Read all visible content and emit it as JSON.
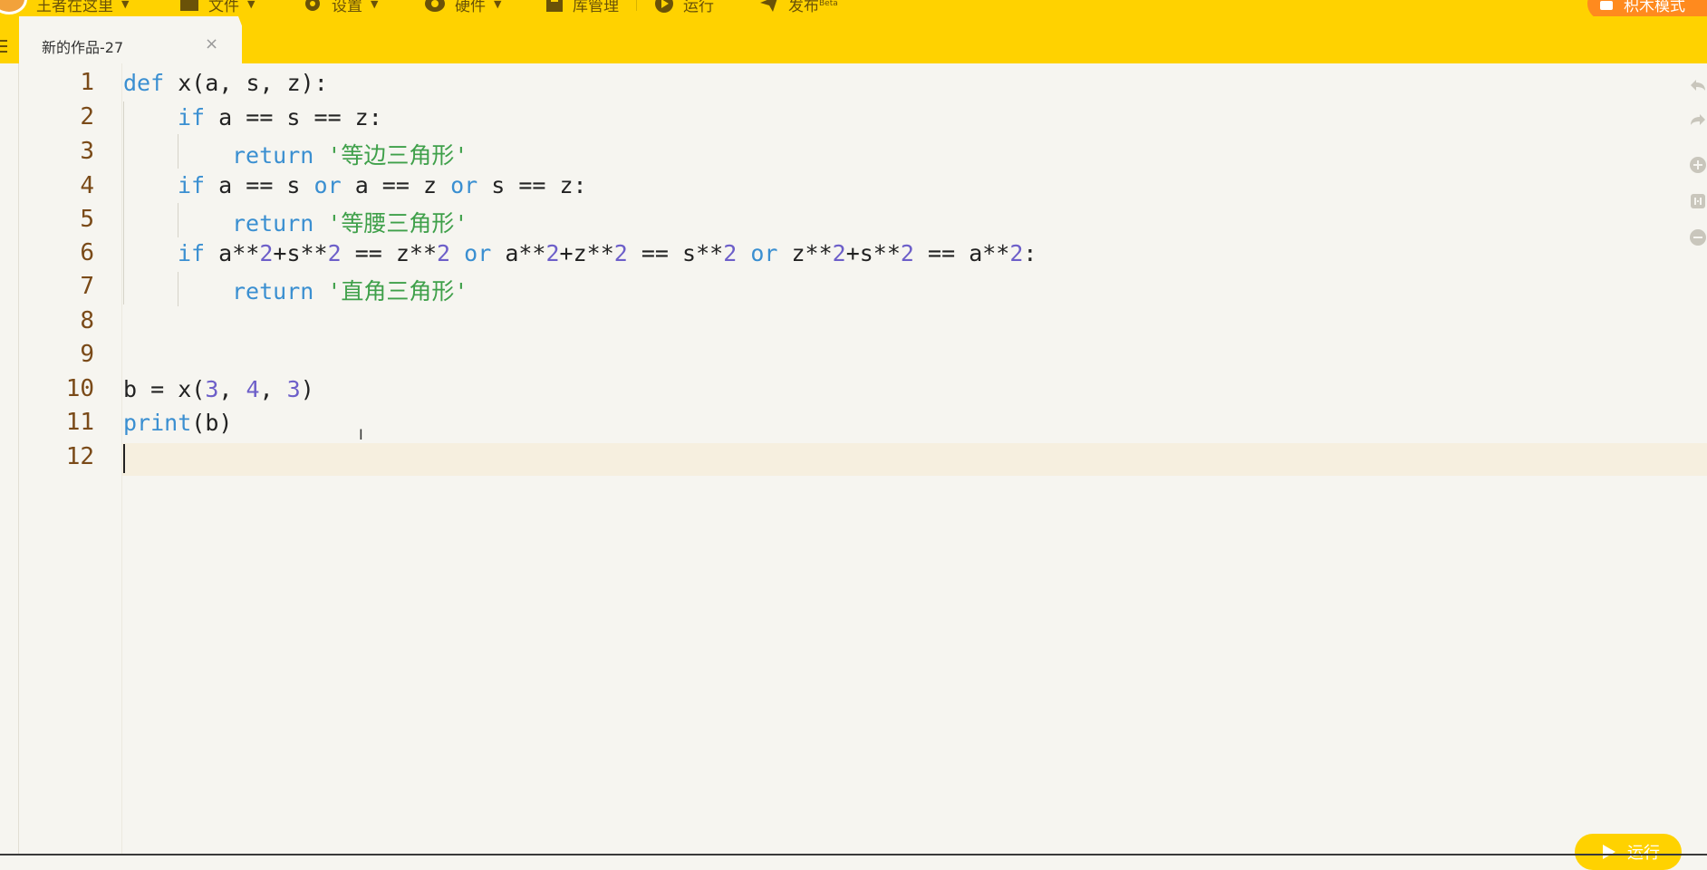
{
  "menu": {
    "user": "王者在这里",
    "file": "文件",
    "settings": "设置",
    "hardware": "硬件",
    "library": "库管理",
    "run": "运行",
    "publish": "发布",
    "publish_badge": "Beta",
    "block_mode": "积木模式"
  },
  "tab": {
    "title": "新的作品-27",
    "close": "×"
  },
  "editor": {
    "line_numbers": [
      "1",
      "2",
      "3",
      "4",
      "5",
      "6",
      "7",
      "8",
      "9",
      "10",
      "11",
      "12"
    ],
    "lines": [
      [
        "def x(a, s, z):"
      ],
      [
        "if a == s == z:"
      ],
      [
        "return '等边三角形'"
      ],
      [
        "if a == s or a == z or s == z:"
      ],
      [
        "return '等腰三角形'"
      ],
      [
        "if a**2+s**2 == z**2 or a**2+z**2 == s**2 or z**2+s**2 == a**2:"
      ],
      [
        "return '直角三角形'"
      ],
      [
        ""
      ],
      [
        ""
      ],
      [
        "b = x(3, 4, 3)"
      ],
      [
        "print(b)"
      ],
      [
        ""
      ]
    ],
    "tokens": {
      "l1_kw": "def",
      "l1_rest": " x(a, s, z):",
      "l2_kw": "if",
      "l2_rest": " a == s == z:",
      "l3_kw": "return",
      "l3_str": "'等边三角形'",
      "l4_kw1": "if",
      "l4_a": " a == s ",
      "l4_or1": "or",
      "l4_b": " a == z ",
      "l4_or2": "or",
      "l4_c": " s == z:",
      "l5_kw": "return",
      "l5_str": "'等腰三角形'",
      "l6_kw": "if",
      "l6_1": " a**",
      "l6_n1": "2",
      "l6_2": "+s**",
      "l6_n2": "2",
      "l6_3": " == z**",
      "l6_n3": "2",
      "l6_or1": "or",
      "l6_4": " a**",
      "l6_n4": "2",
      "l6_5": "+z**",
      "l6_n5": "2",
      "l6_6": " == s**",
      "l6_n6": "2",
      "l6_or2": "or",
      "l6_7": " z**",
      "l6_n7": "2",
      "l6_8": "+s**",
      "l6_n8": "2",
      "l6_9": " == a**",
      "l6_n9": "2",
      "l6_10": ":",
      "l7_kw": "return",
      "l7_str": "'直角三角形'",
      "l10_a": "b = x(",
      "l10_n1": "3",
      "l10_c1": ", ",
      "l10_n2": "4",
      "l10_c2": ", ",
      "l10_n3": "3",
      "l10_e": ")",
      "l11_kw": "print",
      "l11_rest": "(b)"
    }
  },
  "run_button": "运行",
  "colors": {
    "toolbar": "#ffd200",
    "keyword": "#3a8fd1",
    "number": "#6d5fc9",
    "string": "#3fa04a",
    "accent_button": "#ff8a1e"
  }
}
